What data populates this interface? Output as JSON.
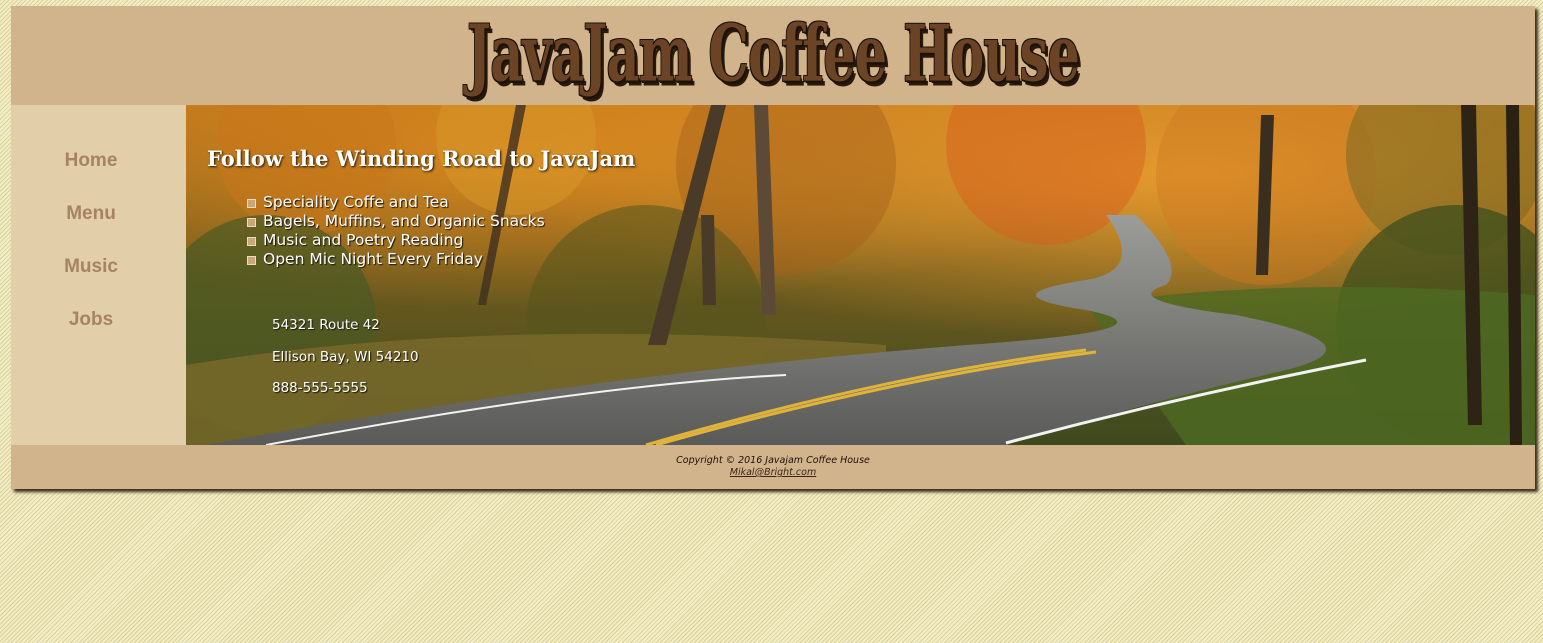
{
  "header": {
    "logo_text": "JavaJam Coffee House"
  },
  "nav": {
    "items": [
      {
        "label": "Home"
      },
      {
        "label": "Menu"
      },
      {
        "label": "Music"
      },
      {
        "label": "Jobs"
      }
    ]
  },
  "hero": {
    "heading": "Follow the Winding Road to JavaJam",
    "features": [
      "Speciality Coffe and Tea",
      "Bagels, Muffins, and Organic Snacks",
      "Music and Poetry Reading",
      "Open Mic Night Every Friday"
    ],
    "address": {
      "street": "54321 Route 42",
      "city": "Ellison Bay, WI 54210",
      "phone": "888-555-5555"
    },
    "image_description_icon": "autumn-road-image"
  },
  "footer": {
    "copyright": "Copyright © 2016 Javajam Coffee House",
    "email": "Mikal@Bright.com"
  },
  "colors": {
    "page_background": "#ece6b4",
    "wrapper": "#d2b48c",
    "nav_background": "#e2cfaa",
    "nav_link": "#a88362",
    "logo": "#6b4426"
  }
}
